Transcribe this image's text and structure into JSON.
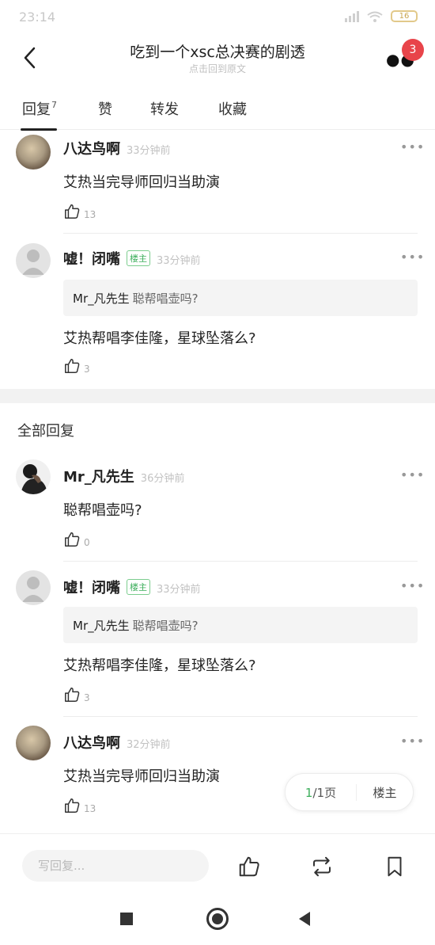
{
  "status_bar": {
    "time": "23:14",
    "battery": "16"
  },
  "header": {
    "title": "吃到一个xsc总决赛的剧透",
    "subtitle": "点击回到原文",
    "badge_count": "3"
  },
  "tabs": [
    {
      "label": "回复",
      "count": "7"
    },
    {
      "label": "赞"
    },
    {
      "label": "转发"
    },
    {
      "label": "收藏"
    }
  ],
  "hot_replies": [
    {
      "user": "八达鸟啊",
      "time": "33分钟前",
      "content": "艾热当完导师回归当助演",
      "likes": "13"
    },
    {
      "user": "嘘！闭嘴",
      "op_tag": "楼主",
      "time": "33分钟前",
      "quote_user": "Mr_凡先生",
      "quote_text": "聪帮唱壶吗?",
      "content": "艾热帮唱李佳隆，星球坠落么?",
      "likes": "3"
    }
  ],
  "all_replies_label": "全部回复",
  "all_replies": [
    {
      "user": "Mr_凡先生",
      "time": "36分钟前",
      "content": "聪帮唱壶吗?",
      "likes": "0"
    },
    {
      "user": "嘘！闭嘴",
      "op_tag": "楼主",
      "time": "33分钟前",
      "quote_user": "Mr_凡先生",
      "quote_text": "聪帮唱壶吗?",
      "content": "艾热帮唱李佳隆，星球坠落么?",
      "likes": "3"
    },
    {
      "user": "八达鸟啊",
      "time": "32分钟前",
      "content": "艾热当完导师回归当助演",
      "likes": "13"
    }
  ],
  "pager": {
    "current": "1",
    "rest": "/1页",
    "op_label": "楼主"
  },
  "bottom_bar": {
    "placeholder": "写回复..."
  },
  "icons": [
    "back-icon",
    "more-icon",
    "like-icon",
    "repost-icon",
    "bookmark-icon"
  ],
  "colors": {
    "accent_green": "#3cae5b",
    "badge_red": "#e8444a"
  }
}
